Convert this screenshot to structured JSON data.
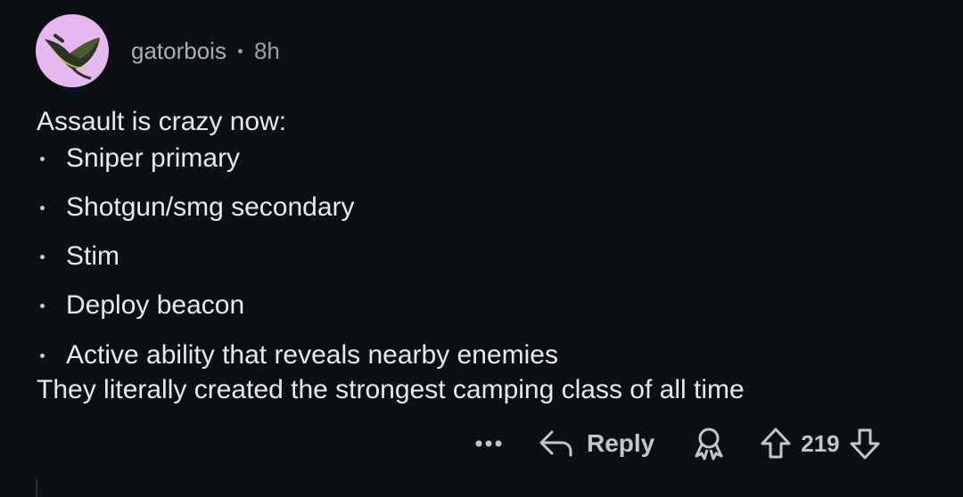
{
  "comment": {
    "username": "gatorbois",
    "time_ago": "8h",
    "intro": "Assault is crazy now:",
    "bullets": [
      "Sniper primary",
      "Shotgun/smg secondary",
      "Stim",
      "Deploy beacon",
      "Active ability that reveals nearby enemies"
    ],
    "outro": "They literally created the strongest camping class of all time"
  },
  "actions": {
    "more_icon": "more-dots-icon",
    "reply_label": "Reply",
    "reply_icon": "reply-arrow-icon",
    "award_icon": "award-icon",
    "upvote_icon": "upvote-arrow-icon",
    "score": "219",
    "downvote_icon": "downvote-arrow-icon"
  },
  "colors": {
    "background": "#0d1013",
    "text": "#e8ebee",
    "muted": "#9ba1a7",
    "avatar_bg": "#e5b9f0"
  }
}
